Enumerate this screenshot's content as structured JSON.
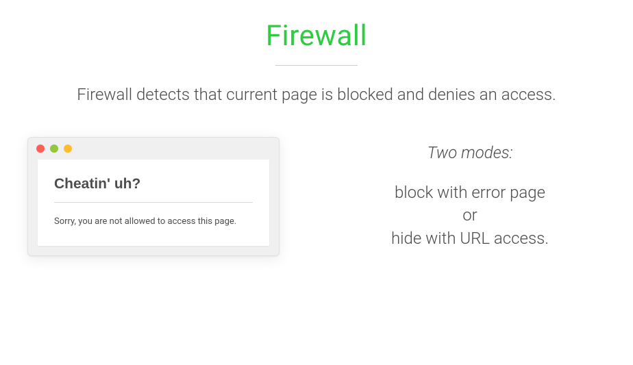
{
  "header": {
    "title": "Firewall"
  },
  "description": "Firewall detects that current page is blocked and denies an access.",
  "browser": {
    "error_heading": "Cheatin' uh?",
    "error_message": "Sorry, you are not allowed to access this page."
  },
  "modes": {
    "title": "Two modes:",
    "option1": "block with error page",
    "separator": "or",
    "option2": "hide with URL access."
  }
}
